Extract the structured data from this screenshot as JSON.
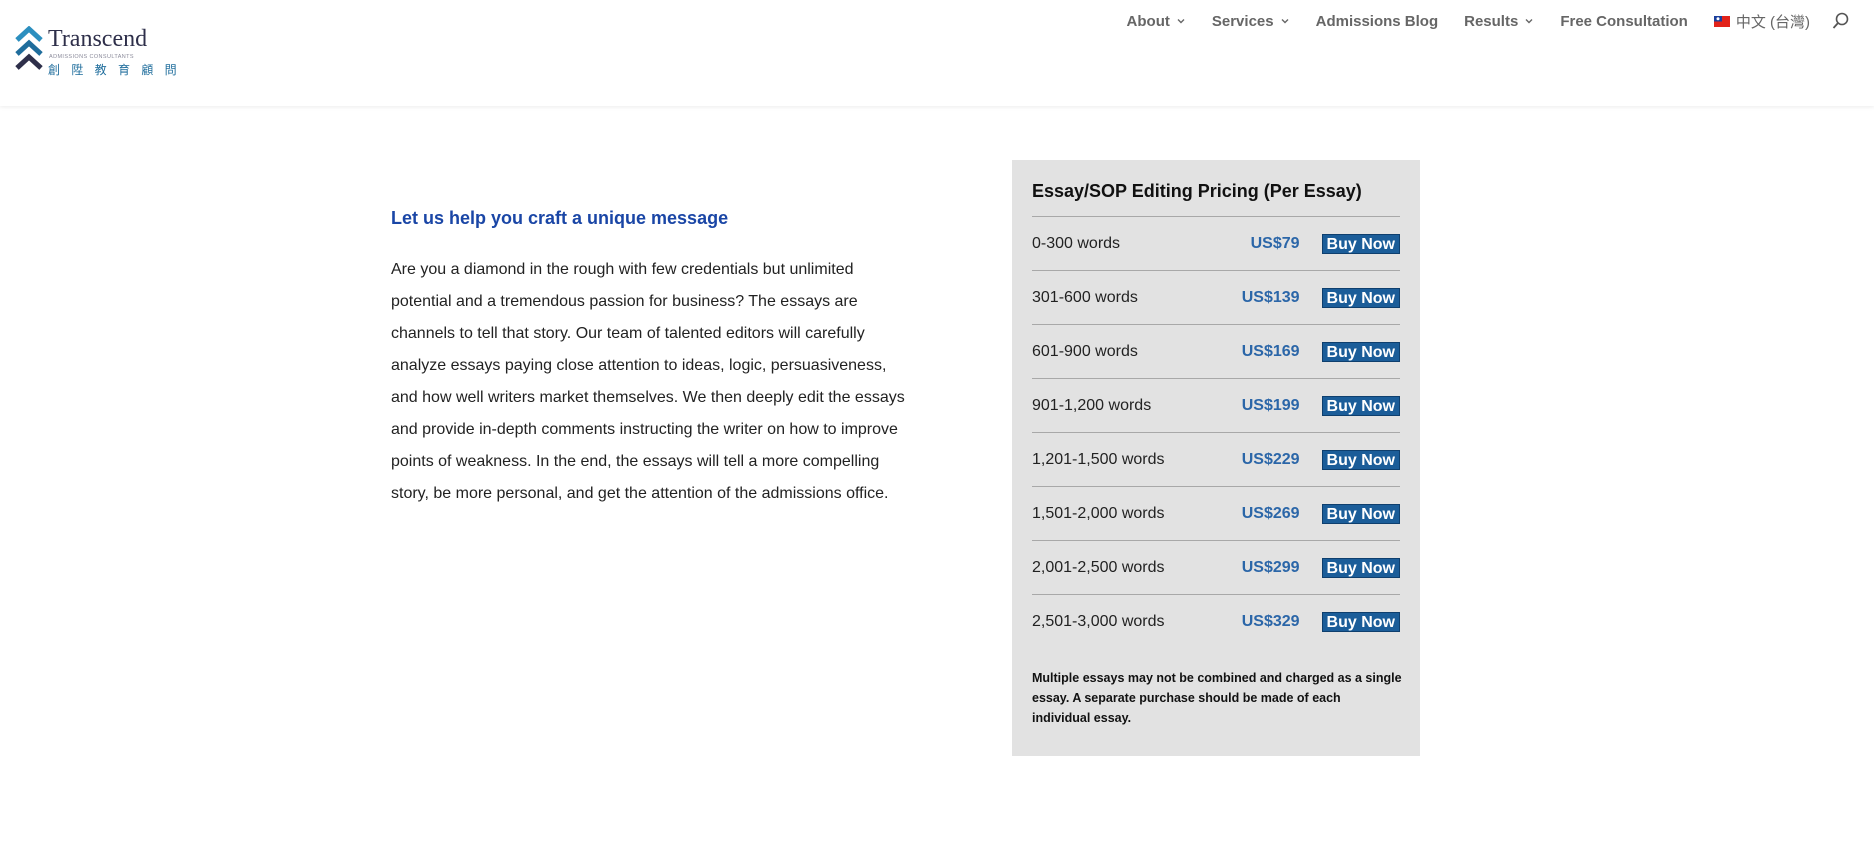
{
  "header": {
    "logo": {
      "brand": "Transcend",
      "subtitle": "ADMISSIONS CONSULTANTS",
      "chinese": "創 陞 教 育 顧 問"
    },
    "nav": [
      {
        "label": "About",
        "has_dropdown": true
      },
      {
        "label": "Services",
        "has_dropdown": true
      },
      {
        "label": "Admissions Blog",
        "has_dropdown": false
      },
      {
        "label": "Results",
        "has_dropdown": true
      },
      {
        "label": "Free Consultation",
        "has_dropdown": false
      }
    ],
    "language": "中文 (台灣)",
    "icons": {
      "search": "search-icon",
      "flag": "taiwan-flag-icon",
      "dropdown": "chevron-down-icon"
    }
  },
  "main": {
    "heading": "Let us help you craft a unique message",
    "paragraph": "Are you a diamond in the rough with few credentials but unlimited potential and a tremendous passion for business? The essays are channels to tell that story. Our team of talented editors will carefully analyze essays paying close attention to ideas, logic, persuasiveness, and how well writers market themselves. We then deeply edit the essays and provide in-depth comments instructing the writer on how to improve points of weakness. In the end, the essays will tell a more compelling story, be more personal, and get the attention of the admissions office."
  },
  "pricing": {
    "title": "Essay/SOP Editing Pricing (Per Essay)",
    "rows": [
      {
        "words": "0-300 words",
        "price": "US$79",
        "button": "Buy Now"
      },
      {
        "words": "301-600 words",
        "price": "US$139",
        "button": "Buy Now"
      },
      {
        "words": "601-900 words",
        "price": "US$169",
        "button": "Buy Now"
      },
      {
        "words": "901-1,200 words",
        "price": "US$199",
        "button": "Buy Now"
      },
      {
        "words": "1,201-1,500 words",
        "price": "US$229",
        "button": "Buy Now"
      },
      {
        "words": "1,501-2,000 words",
        "price": "US$269",
        "button": "Buy Now"
      },
      {
        "words": "2,001-2,500 words",
        "price": "US$299",
        "button": "Buy Now"
      },
      {
        "words": "2,501-3,000 words",
        "price": "US$329",
        "button": "Buy Now"
      }
    ],
    "note": "Multiple essays may not be combined and charged as a single essay. A separate purchase should be made of each individual essay."
  },
  "colors": {
    "accent_blue": "#1a46a6",
    "price_blue": "#2b66a8",
    "button_blue": "#1b5d99",
    "panel_bg": "#e2e2e2"
  }
}
